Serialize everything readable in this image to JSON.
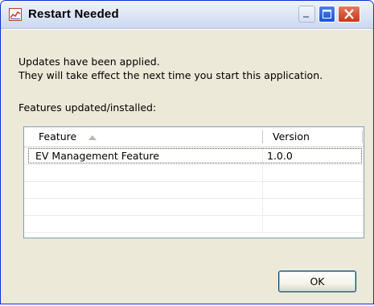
{
  "window": {
    "title": "Restart Needed",
    "icon": "chart-icon",
    "controls": [
      "minimize-icon",
      "maximize-icon",
      "close-icon"
    ]
  },
  "message": {
    "line1": "Updates have been applied.",
    "line2": "They will take effect the next time you start this application."
  },
  "features": {
    "label": "Features updated/installed:",
    "columns": {
      "feature": "Feature",
      "version": "Version"
    },
    "sort": "feature-ascending",
    "rows": [
      {
        "feature": "EV Management Feature",
        "version": "1.0.0"
      }
    ]
  },
  "buttons": {
    "ok": "OK"
  },
  "colors": {
    "dialog_bg": "#ece9d8",
    "close_button": "#c5381a",
    "maximize_button": "#1f52d4"
  }
}
